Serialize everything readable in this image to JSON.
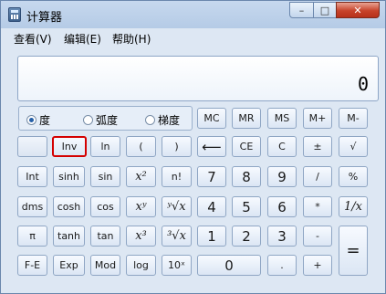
{
  "window": {
    "title": "计算器",
    "min_symbol": "–",
    "max_symbol": "□",
    "close_symbol": "✕"
  },
  "menu": {
    "view": "查看(V)",
    "edit": "编辑(E)",
    "help": "帮助(H)"
  },
  "display": {
    "value": "0"
  },
  "mode": {
    "degrees": "度",
    "radians": "弧度",
    "grads": "梯度",
    "selected": "degrees"
  },
  "buttons": {
    "mc": "MC",
    "mr": "MR",
    "ms": "MS",
    "mplus": "M+",
    "mminus": "M-",
    "inv": "Inv",
    "ln": "ln",
    "lparen": "(",
    "rparen": ")",
    "back": "⟵",
    "ce": "CE",
    "c": "C",
    "plusminus": "±",
    "sqrt": "√",
    "int": "Int",
    "sinh": "sinh",
    "sin": "sin",
    "x2": "x²",
    "fact": "n!",
    "n7": "7",
    "n8": "8",
    "n9": "9",
    "div": "/",
    "pct": "%",
    "dms": "dms",
    "cosh": "cosh",
    "cos": "cos",
    "xy": "xʸ",
    "yroot": "ʸ√x",
    "n4": "4",
    "n5": "5",
    "n6": "6",
    "mul": "*",
    "recip": "1/x",
    "pi": "π",
    "tanh": "tanh",
    "tan": "tan",
    "x3": "x³",
    "cuberoot": "³√x",
    "n1": "1",
    "n2": "2",
    "n3": "3",
    "minus": "-",
    "equals": "=",
    "fe": "F-E",
    "exp": "Exp",
    "mod": "Mod",
    "log": "log",
    "tenx": "10ˣ",
    "n0": "0",
    "dot": ".",
    "plus": "+"
  }
}
